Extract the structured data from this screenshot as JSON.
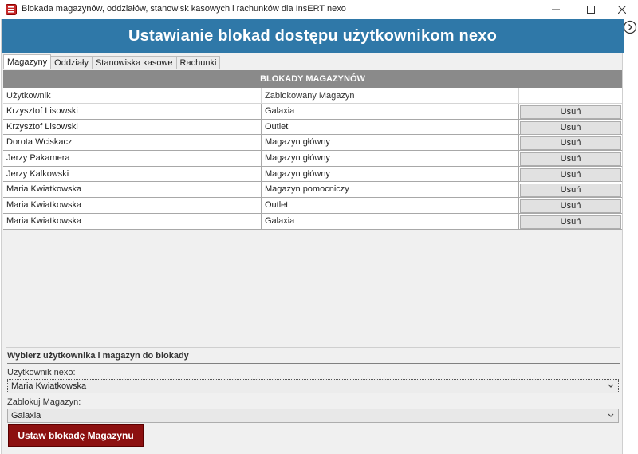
{
  "window": {
    "title": "Blokada magazynów, oddziałów, stanowisk kasowych i rachunków dla InsERT nexo",
    "icon": "app-icon"
  },
  "header": {
    "title": "Ustawianie blokad dostępu użytkownikom nexo"
  },
  "tabs": [
    {
      "label": "Magazyny",
      "active": true
    },
    {
      "label": "Oddziały",
      "active": false
    },
    {
      "label": "Stanowiska kasowe",
      "active": false
    },
    {
      "label": "Rachunki",
      "active": false
    }
  ],
  "grid": {
    "banner": "BLOKADY MAGAZYNÓW",
    "columns": [
      "Użytkownik",
      "Zablokowany Magazyn",
      ""
    ],
    "rows": [
      {
        "user": "Krzysztof Lisowski",
        "magazyn": "Galaxia",
        "action": "Usuń"
      },
      {
        "user": "Krzysztof Lisowski",
        "magazyn": "Outlet",
        "action": "Usuń"
      },
      {
        "user": "Dorota Wciskacz",
        "magazyn": "Magazyn główny",
        "action": "Usuń"
      },
      {
        "user": "Jerzy Pakamera",
        "magazyn": "Magazyn główny",
        "action": "Usuń"
      },
      {
        "user": "Jerzy Kalkowski",
        "magazyn": "Magazyn główny",
        "action": "Usuń"
      },
      {
        "user": "Maria Kwiatkowska",
        "magazyn": "Magazyn pomocniczy",
        "action": "Usuń"
      },
      {
        "user": "Maria Kwiatkowska",
        "magazyn": "Outlet",
        "action": "Usuń"
      },
      {
        "user": "Maria Kwiatkowska",
        "magazyn": "Galaxia",
        "action": "Usuń"
      }
    ]
  },
  "form": {
    "section_title": "Wybierz użytkownika i magazyn do blokady",
    "user_label": "Użytkownik nexo:",
    "user_value": "Maria Kwiatkowska",
    "magazyn_label": "Zablokuj Magazyn:",
    "magazyn_value": "Galaxia",
    "submit_label": "Ustaw blokadę Magazynu"
  },
  "colors": {
    "header_bg": "#2f78a8",
    "banner_bg": "#8a8a8a",
    "submit_bg": "#8c1010"
  }
}
